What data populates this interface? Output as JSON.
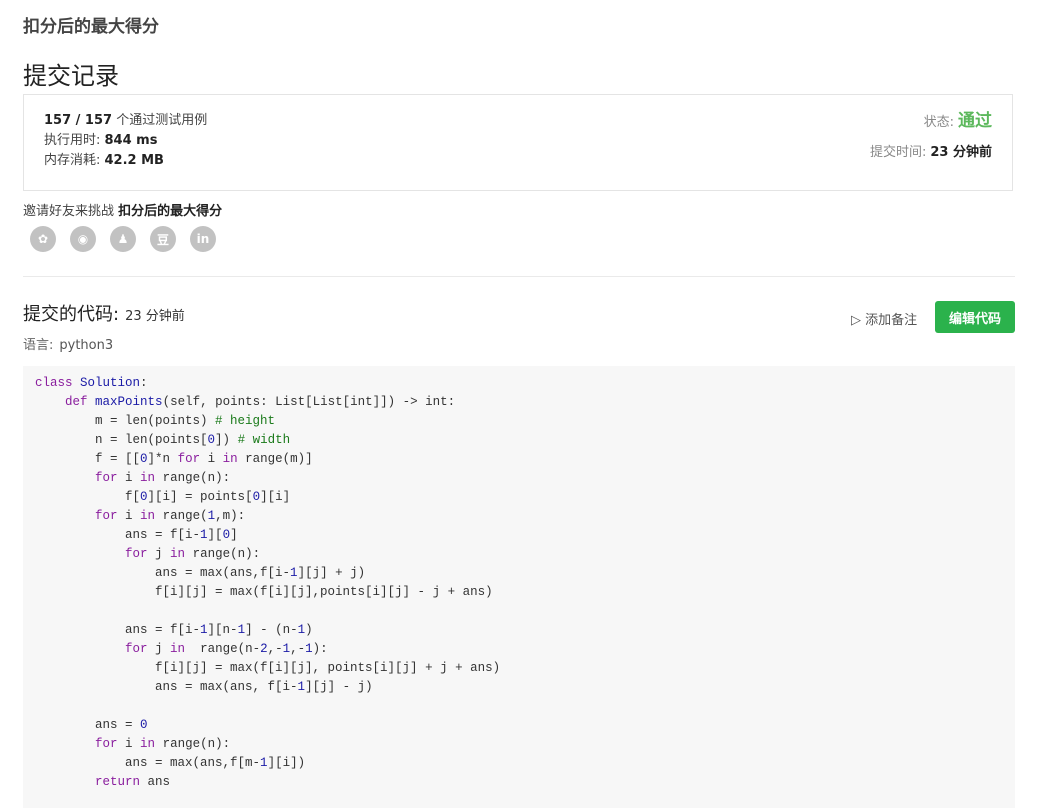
{
  "problem_title": "扣分后的最大得分",
  "page_title": "提交记录",
  "summary": {
    "tests_passed": "157 / 157",
    "tests_label": " 个通过测试用例",
    "runtime_label": "执行用时: ",
    "runtime_value": "844 ms",
    "memory_label": "内存消耗: ",
    "memory_value": "42.2 MB",
    "status_label": "状态:",
    "status_value": "通过",
    "submit_time_label": "提交时间:",
    "submit_time_value": "23 分钟前"
  },
  "invite": {
    "prefix": "邀请好友来挑战 ",
    "problem": "扣分后的最大得分"
  },
  "share_icons": [
    {
      "name": "wechat-icon",
      "glyph": "✿"
    },
    {
      "name": "weibo-icon",
      "glyph": "◉"
    },
    {
      "name": "qq-icon",
      "glyph": "♟"
    },
    {
      "name": "douban-icon",
      "glyph": "豆"
    },
    {
      "name": "linkedin-icon",
      "glyph": "in"
    }
  ],
  "code_section": {
    "title": "提交的代码:",
    "time": "23 分钟前",
    "language_label": "语言:",
    "language_value": "python3",
    "add_note": "添加备注",
    "edit_button": "编辑代码"
  },
  "code_lines": [
    "class Solution:",
    "    def maxPoints(self, points: List[List[int]]) -> int:",
    "        m = len(points) # height",
    "        n = len(points[0]) # width",
    "        f = [[0]*n for i in range(m)]",
    "        for i in range(n):",
    "            f[0][i] = points[0][i]",
    "        for i in range(1,m):",
    "            ans = f[i-1][0]",
    "            for j in range(n):",
    "                ans = max(ans,f[i-1][j] + j)",
    "                f[i][j] = max(f[i][j],points[i][j] - j + ans)",
    "",
    "            ans = f[i-1][n-1] - (n-1)",
    "            for j in  range(n-2,-1,-1):",
    "                f[i][j] = max(f[i][j], points[i][j] + j + ans)",
    "                ans = max(ans, f[i-1][j] - j)",
    "",
    "        ans = 0",
    "        for i in range(n):",
    "            ans = max(ans,f[m-1][i])",
    "        return ans"
  ],
  "colors": {
    "accent": "#2bb24c",
    "passed": "#5cb85c",
    "code_bg": "#f7f7f7"
  }
}
